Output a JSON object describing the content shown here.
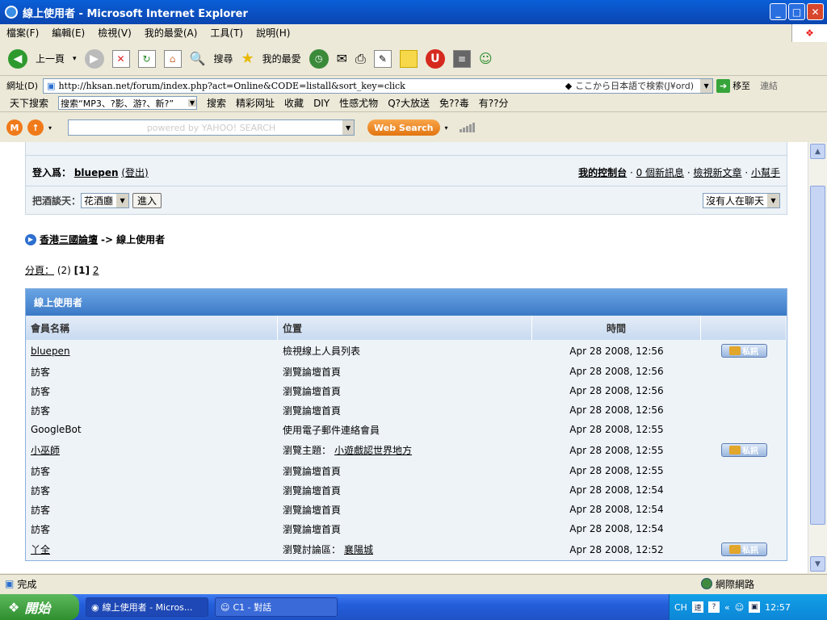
{
  "window": {
    "title": "線上使用者 - Microsoft Internet Explorer"
  },
  "menu": [
    "檔案(F)",
    "編輯(E)",
    "檢視(V)",
    "我的最愛(A)",
    "工具(T)",
    "說明(H)"
  ],
  "toolbar": {
    "back": "上一頁",
    "search": "搜尋",
    "favorites": "我的最愛"
  },
  "address": {
    "label": "網址(D)",
    "url": "http://hksan.net/forum/index.php?act=Online&CODE=listall&sort_key=click",
    "jp_search": "ここから日本語で検索(J¥ord)",
    "go": "移至",
    "links": "連結"
  },
  "linksbar": {
    "search_label": "天下搜索",
    "search_value": "搜索“MP3、?影、游?、新?”",
    "items": [
      "搜索",
      "精彩网址",
      "收藏",
      "DIY",
      "性感尤物",
      "Q?大放送",
      "免??毒",
      "有??分"
    ]
  },
  "yahoo": {
    "placeholder": "powered by YAHOO! SEARCH",
    "button": "Web Search"
  },
  "forum": {
    "login_prefix": "登入爲：",
    "username": "bluepen",
    "logout": "(登出)",
    "control_panel": "我的控制台",
    "new_msgs": "0 個新訊息",
    "new_posts": "檢視新文章",
    "helper": "小幫手",
    "chat_label": "把酒談天：",
    "chat_room": "花酒廳",
    "enter_btn": "進入",
    "chat_status": "沒有人在聊天",
    "breadcrumb_home": "香港三國論壇",
    "breadcrumb_sep": "->",
    "breadcrumb_current": "線上使用者",
    "pages_label": "分頁：",
    "pages_count": "(2)",
    "page_current": "[1]",
    "page_next": "2"
  },
  "table": {
    "caption": "線上使用者",
    "headers": [
      "會員名稱",
      "位置",
      "時間",
      ""
    ],
    "pm_label": "私訊",
    "rows": [
      {
        "name": "bluepen",
        "loc": "檢視線上人員列表",
        "link": "",
        "time": "Apr 28 2008, 12:56",
        "pm": true
      },
      {
        "name": "訪客",
        "loc": "瀏覽論壇首頁",
        "link": "",
        "time": "Apr 28 2008, 12:56",
        "pm": false
      },
      {
        "name": "訪客",
        "loc": "瀏覽論壇首頁",
        "link": "",
        "time": "Apr 28 2008, 12:56",
        "pm": false
      },
      {
        "name": "訪客",
        "loc": "瀏覽論壇首頁",
        "link": "",
        "time": "Apr 28 2008, 12:56",
        "pm": false
      },
      {
        "name": "GoogleBot",
        "loc": "使用電子郵件連絡會員",
        "link": "",
        "time": "Apr 28 2008, 12:55",
        "pm": false
      },
      {
        "name": "小巫師",
        "loc": "瀏覽主題：",
        "link": "小遊戲認世界地方",
        "time": "Apr 28 2008, 12:55",
        "pm": true
      },
      {
        "name": "訪客",
        "loc": "瀏覽論壇首頁",
        "link": "",
        "time": "Apr 28 2008, 12:55",
        "pm": false
      },
      {
        "name": "訪客",
        "loc": "瀏覽論壇首頁",
        "link": "",
        "time": "Apr 28 2008, 12:54",
        "pm": false
      },
      {
        "name": "訪客",
        "loc": "瀏覽論壇首頁",
        "link": "",
        "time": "Apr 28 2008, 12:54",
        "pm": false
      },
      {
        "name": "訪客",
        "loc": "瀏覽論壇首頁",
        "link": "",
        "time": "Apr 28 2008, 12:54",
        "pm": false
      },
      {
        "name": "丫全",
        "loc": "瀏覽討論區：",
        "link": "襄陽城",
        "time": "Apr 28 2008, 12:52",
        "pm": true
      }
    ]
  },
  "status": {
    "text": "完成",
    "zone": "網際網路"
  },
  "taskbar": {
    "start": "開始",
    "tasks": [
      "線上使用者 - Micros...",
      "C1 - 對話"
    ],
    "lang": "CH",
    "time": "12:57"
  }
}
